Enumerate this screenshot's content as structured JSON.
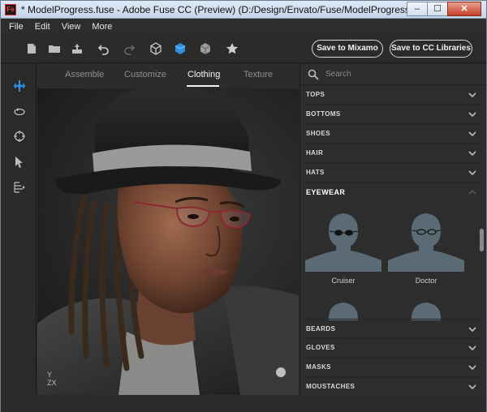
{
  "window": {
    "title": "* ModelProgress.fuse - Adobe Fuse CC (Preview) (D:/Design/Envato/Fuse/ModelProgress.fuse)",
    "app_icon_text": "Fs",
    "minimize": "–",
    "maximize": "☐",
    "close": "✕"
  },
  "menu": [
    "File",
    "Edit",
    "View",
    "More"
  ],
  "toolbar": {
    "save_mixamo": "Save to Mixamo",
    "save_cc": "Save to CC Libraries"
  },
  "tabs": [
    "Assemble",
    "Customize",
    "Clothing",
    "Texture"
  ],
  "active_tab": "Clothing",
  "viewport": {
    "axis_y": "Y",
    "axis_zx": "ZX"
  },
  "panel": {
    "search_placeholder": "Search",
    "categories": [
      "TOPS",
      "BOTTOMS",
      "SHOES",
      "HAIR",
      "HATS",
      "EYEWEAR",
      "BEARDS",
      "GLOVES",
      "MASKS",
      "MOUSTACHES"
    ],
    "open_category": "EYEWEAR",
    "items": [
      "Cruiser",
      "Doctor"
    ]
  },
  "colors": {
    "accent": "#2f8fe3",
    "thumb_bg": "#5b6b76"
  }
}
